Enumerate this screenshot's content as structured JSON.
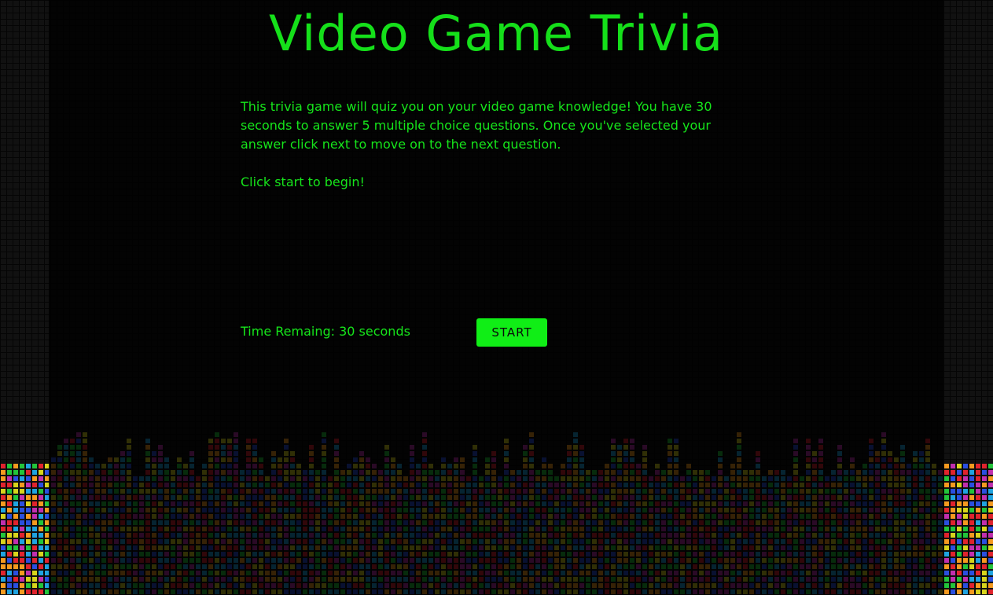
{
  "app": {
    "title": "Video Game Trivia"
  },
  "intro": {
    "description": "This trivia game will quiz you on your video game knowledge! You have 30 seconds to answer 5 multiple choice questions. Once you've selected your answer click next to move on to the next question.",
    "prompt": "Click start to begin!"
  },
  "timer": {
    "label": "Time Remaing: 30 seconds"
  },
  "controls": {
    "start_label": "START"
  },
  "colors": {
    "text": "#16e51b",
    "button": "#10ee16",
    "background": "#0a0a0a"
  },
  "background": {
    "style": "tetris-bricks"
  }
}
